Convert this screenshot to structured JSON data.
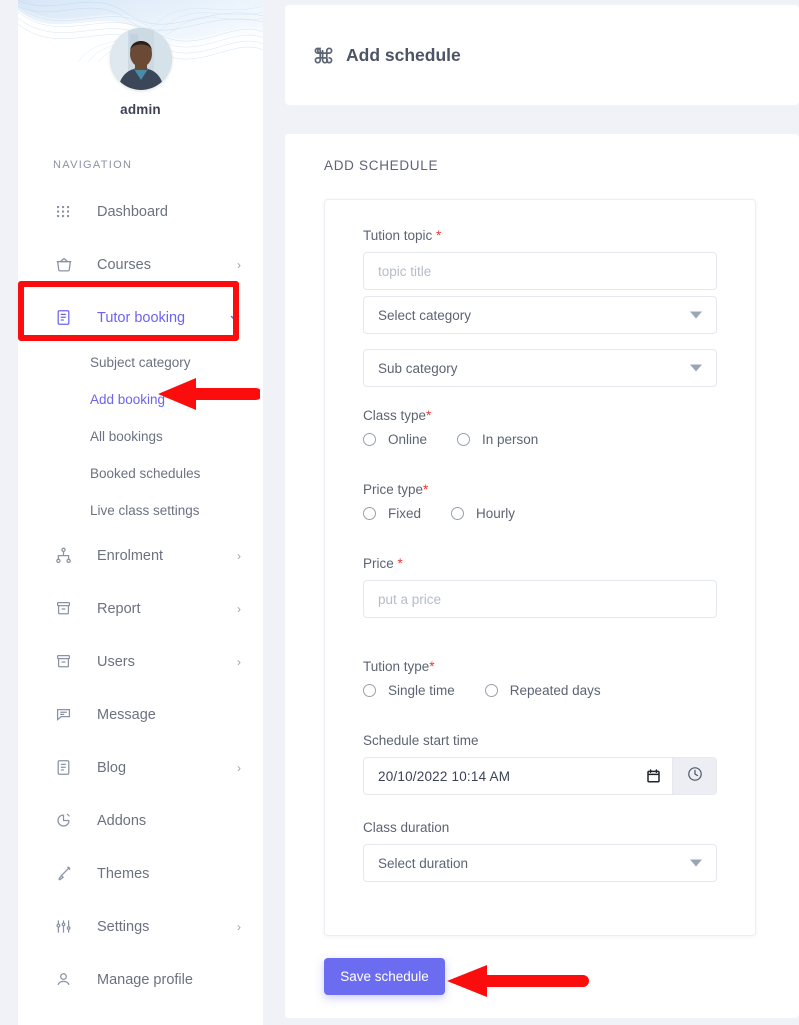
{
  "sidebar": {
    "profile": {
      "name": "admin",
      "avatar_icon": "user-avatar-photo"
    },
    "nav_heading": "NAVIGATION",
    "items": [
      {
        "label": "Dashboard",
        "icon": "grid-dots-icon",
        "caret": "",
        "active": false
      },
      {
        "label": "Courses",
        "icon": "basket-icon",
        "caret": "›",
        "active": false
      },
      {
        "label": "Tutor booking",
        "icon": "document-list-icon",
        "caret": "⌄",
        "active": true
      },
      {
        "label": "Enrolment",
        "icon": "hierarchy-icon",
        "caret": "›",
        "active": false
      },
      {
        "label": "Report",
        "icon": "archive-icon",
        "caret": "›",
        "active": false
      },
      {
        "label": "Users",
        "icon": "archive-icon",
        "caret": "›",
        "active": false
      },
      {
        "label": "Message",
        "icon": "chat-bubble-icon",
        "caret": "",
        "active": false
      },
      {
        "label": "Blog",
        "icon": "document-list-icon",
        "caret": "›",
        "active": false
      },
      {
        "label": "Addons",
        "icon": "pie-chart-icon",
        "caret": "",
        "active": false
      },
      {
        "label": "Themes",
        "icon": "brush-icon",
        "caret": "",
        "active": false
      },
      {
        "label": "Settings",
        "icon": "sliders-icon",
        "caret": "›",
        "active": false
      },
      {
        "label": "Manage profile",
        "icon": "person-icon",
        "caret": "",
        "active": false
      }
    ],
    "subnav": [
      {
        "label": "Subject category",
        "active": false
      },
      {
        "label": "Add booking",
        "active": true
      },
      {
        "label": "All bookings",
        "active": false
      },
      {
        "label": "Booked schedules",
        "active": false
      },
      {
        "label": "Live class settings",
        "active": false
      }
    ]
  },
  "header": {
    "icon": "command-icon",
    "title": "Add schedule"
  },
  "card": {
    "title": "ADD SCHEDULE"
  },
  "form": {
    "tution_topic": {
      "label": "Tution topic ",
      "required_mark": "*",
      "placeholder": "topic title",
      "value": ""
    },
    "category_select": {
      "value": "Select category"
    },
    "subcategory_select": {
      "value": "Sub category"
    },
    "class_type": {
      "label": "Class type",
      "required_mark": "*",
      "options": [
        "Online",
        "In person"
      ],
      "selected": null
    },
    "price_type": {
      "label": "Price type",
      "required_mark": "*",
      "options": [
        "Fixed",
        "Hourly"
      ],
      "selected": null
    },
    "price": {
      "label": "Price ",
      "required_mark": "*",
      "placeholder": "put a price",
      "value": ""
    },
    "tution_type": {
      "label": "Tution type",
      "required_mark": "*",
      "options": [
        "Single time",
        "Repeated days"
      ],
      "selected": null
    },
    "schedule_start_time": {
      "label": "Schedule start time",
      "value": "20/10/2022 10:14 AM",
      "calendar_icon": "calendar-icon",
      "clock_icon": "clock-icon"
    },
    "class_duration": {
      "label": "Class duration",
      "value": "Select duration"
    },
    "save_label": "Save schedule"
  },
  "colors": {
    "accent": "#6c63f1",
    "button": "#6c6cf0",
    "required": "#f0342c",
    "annotation": "#fc0d0d",
    "page_bg": "#f1f2f7",
    "text": "#5c6473"
  }
}
